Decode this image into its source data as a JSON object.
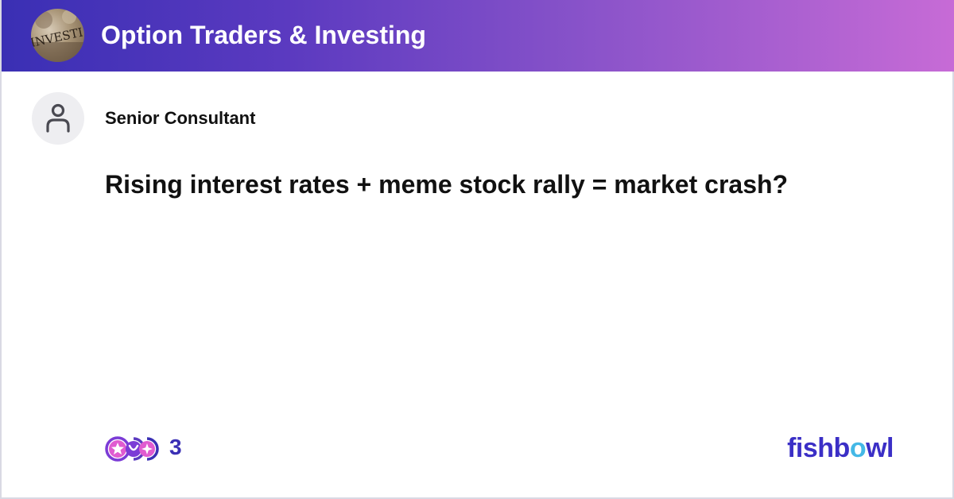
{
  "header": {
    "group_name": "Option Traders & Investing",
    "group_avatar_text": "INVESTI"
  },
  "post": {
    "author": "Senior Consultant",
    "title": "Rising interest rates + meme stock rally = market crash?"
  },
  "footer": {
    "reaction_count": "3",
    "brand_prefix": "fishb",
    "brand_accent": "o",
    "brand_suffix": "wl"
  },
  "colors": {
    "header_gradient_start": "#3a2fb4",
    "header_gradient_end": "#c76bd6",
    "brand": "#3b2fc6",
    "brand_accent": "#44b8e6",
    "reaction_primary": "#7b3bd6",
    "reaction_secondary": "#e05bd0"
  }
}
